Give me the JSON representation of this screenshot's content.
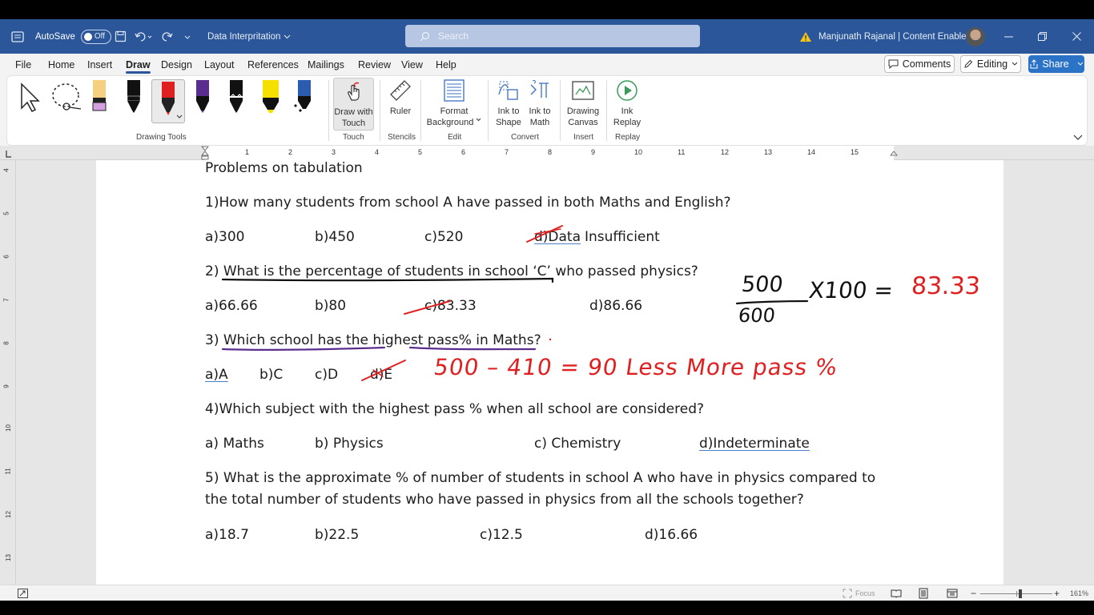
{
  "titlebar": {
    "autosave_label": "AutoSave",
    "autosave_state": "Off",
    "document_title": "Data Interpritation",
    "search_placeholder": "Search",
    "user_name": "Manjunath Rajanal | Content Enablers"
  },
  "menu": {
    "items": [
      "File",
      "Home",
      "Insert",
      "Draw",
      "Design",
      "Layout",
      "References",
      "Mailings",
      "Review",
      "View",
      "Help"
    ],
    "active": "Draw",
    "comments_label": "Comments",
    "editing_label": "Editing",
    "share_label": "Share"
  },
  "ribbon": {
    "draw_with_touch": [
      "Draw with",
      "Touch"
    ],
    "ruler": "Ruler",
    "format_background": [
      "Format",
      "Background"
    ],
    "ink_to_shape": [
      "Ink to",
      "Shape"
    ],
    "ink_to_math": [
      "Ink to",
      "Math"
    ],
    "drawing_canvas": [
      "Drawing",
      "Canvas"
    ],
    "ink_replay": [
      "Ink",
      "Replay"
    ],
    "groups": {
      "drawing_tools": "Drawing Tools",
      "touch": "Touch",
      "stencils": "Stencils",
      "edit": "Edit",
      "convert": "Convert",
      "insert": "Insert",
      "replay": "Replay"
    },
    "pen_colors": [
      "#000000",
      "#e02020",
      "#5b2d8f",
      "#000000",
      "#f5e000",
      "#2a5db0"
    ]
  },
  "ruler": {
    "h_numbers": [
      "1",
      "2",
      "3",
      "4",
      "5",
      "6",
      "7",
      "8",
      "9",
      "10",
      "11",
      "12",
      "13",
      "14",
      "15"
    ],
    "v_numbers": [
      "4",
      "5",
      "6",
      "7",
      "8",
      "9",
      "10",
      "11",
      "12",
      "13"
    ]
  },
  "document": {
    "heading": "Problems on tabulation",
    "q1": "1)How many students from school A have passed in both Maths and English?",
    "q1_options": [
      "a)300",
      "b)450",
      "c)520",
      "d)Data",
      "Insufficient"
    ],
    "q2_prefix": "2) ",
    "q2_underlined": "What is the percentage of students in school ‘C’",
    "q2_rest": " who passed physics?",
    "q2_options": [
      "a)66.66",
      "b)80",
      "c)83.33",
      "d)86.66"
    ],
    "q3_prefix": "3) ",
    "q3_text": "Which school has the highest pass% in Maths?",
    "q3_options": [
      "a)A",
      "b)C",
      "c)D",
      "d)E"
    ],
    "q4": "4)Which subject with the highest pass % when all school are considered?",
    "q4_options": [
      "a) Maths",
      "b) Physics",
      "c) Chemistry",
      "d)Indeterminate"
    ],
    "q5_line1": "5) What is the approximate % of number of students in school A who have in physics compared to",
    "q5_line2": "the total number of students who have passed in physics from all the schools together?",
    "q5_options": [
      "a)18.7",
      "b)22.5",
      "c)12.5",
      "d)16.66"
    ]
  },
  "ink": {
    "fraction_numerator": "500",
    "fraction_denominator": "600",
    "times_hundred": "X100 =",
    "result": "83.33",
    "note": "500 – 410 = 90 Less  More pass %"
  },
  "statusbar": {
    "focus_label": "Focus",
    "zoom": "161%"
  }
}
